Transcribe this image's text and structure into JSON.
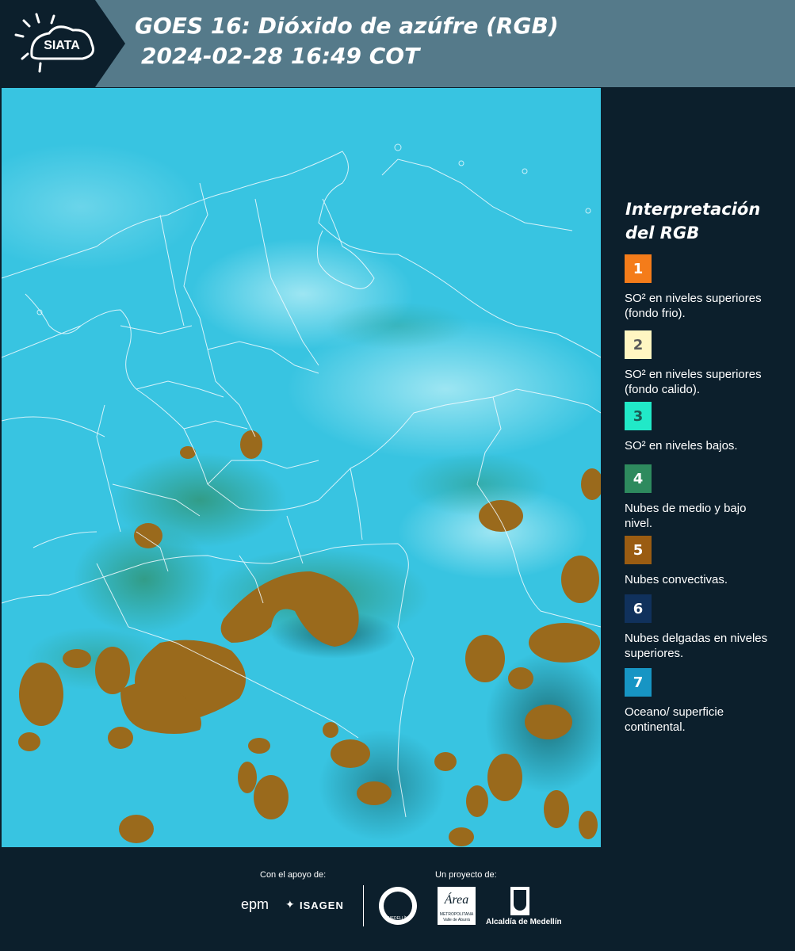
{
  "header": {
    "logo_text": "SIATA",
    "title_line1": "GOES 16: Dióxido de azúfre (RGB)",
    "title_line2": "2024-02-28 16:49 COT"
  },
  "legend": {
    "title_line1": "Interpretación",
    "title_line2": "del RGB",
    "items": [
      {
        "number": "1",
        "color": "#f47c1a",
        "text_color": "#ffffff",
        "label": "SO² en niveles superiores (fondo frio)."
      },
      {
        "number": "2",
        "color": "#fff6c2",
        "text_color": "#5a5a5a",
        "label": "SO² en niveles superiores (fondo calido)."
      },
      {
        "number": "3",
        "color": "#21e9c8",
        "text_color": "#1b5c55",
        "label": "SO² en niveles bajos."
      },
      {
        "number": "4",
        "color": "#2e8a5e",
        "text_color": "#ffffff",
        "label": "Nubes de medio y bajo nivel."
      },
      {
        "number": "5",
        "color": "#9a5c12",
        "text_color": "#ffffff",
        "label": "Nubes convectivas."
      },
      {
        "number": "6",
        "color": "#10315c",
        "text_color": "#ffffff",
        "label": "Nubes delgadas en niveles superiores."
      },
      {
        "number": "7",
        "color": "#1795c4",
        "text_color": "#ffffff",
        "label": "Oceano/ superficie continental."
      }
    ]
  },
  "footer": {
    "support_label": "Con el apoyo de:",
    "project_label": "Un proyecto de:",
    "sponsor1": "epm",
    "sponsor2": "ISAGEN",
    "partner1": "MEDELLÍN",
    "partner2_line1": "Área",
    "partner2_line2": "METROPOLITANA",
    "partner2_line3": "Valle de Aburrá",
    "partner3": "Alcaldía de Medellín"
  },
  "colors": {
    "header_bg": "#557a8a",
    "panel_bg": "#0c1f2c",
    "map_base": "#36c3e0",
    "convective": "#9a6a1c"
  }
}
